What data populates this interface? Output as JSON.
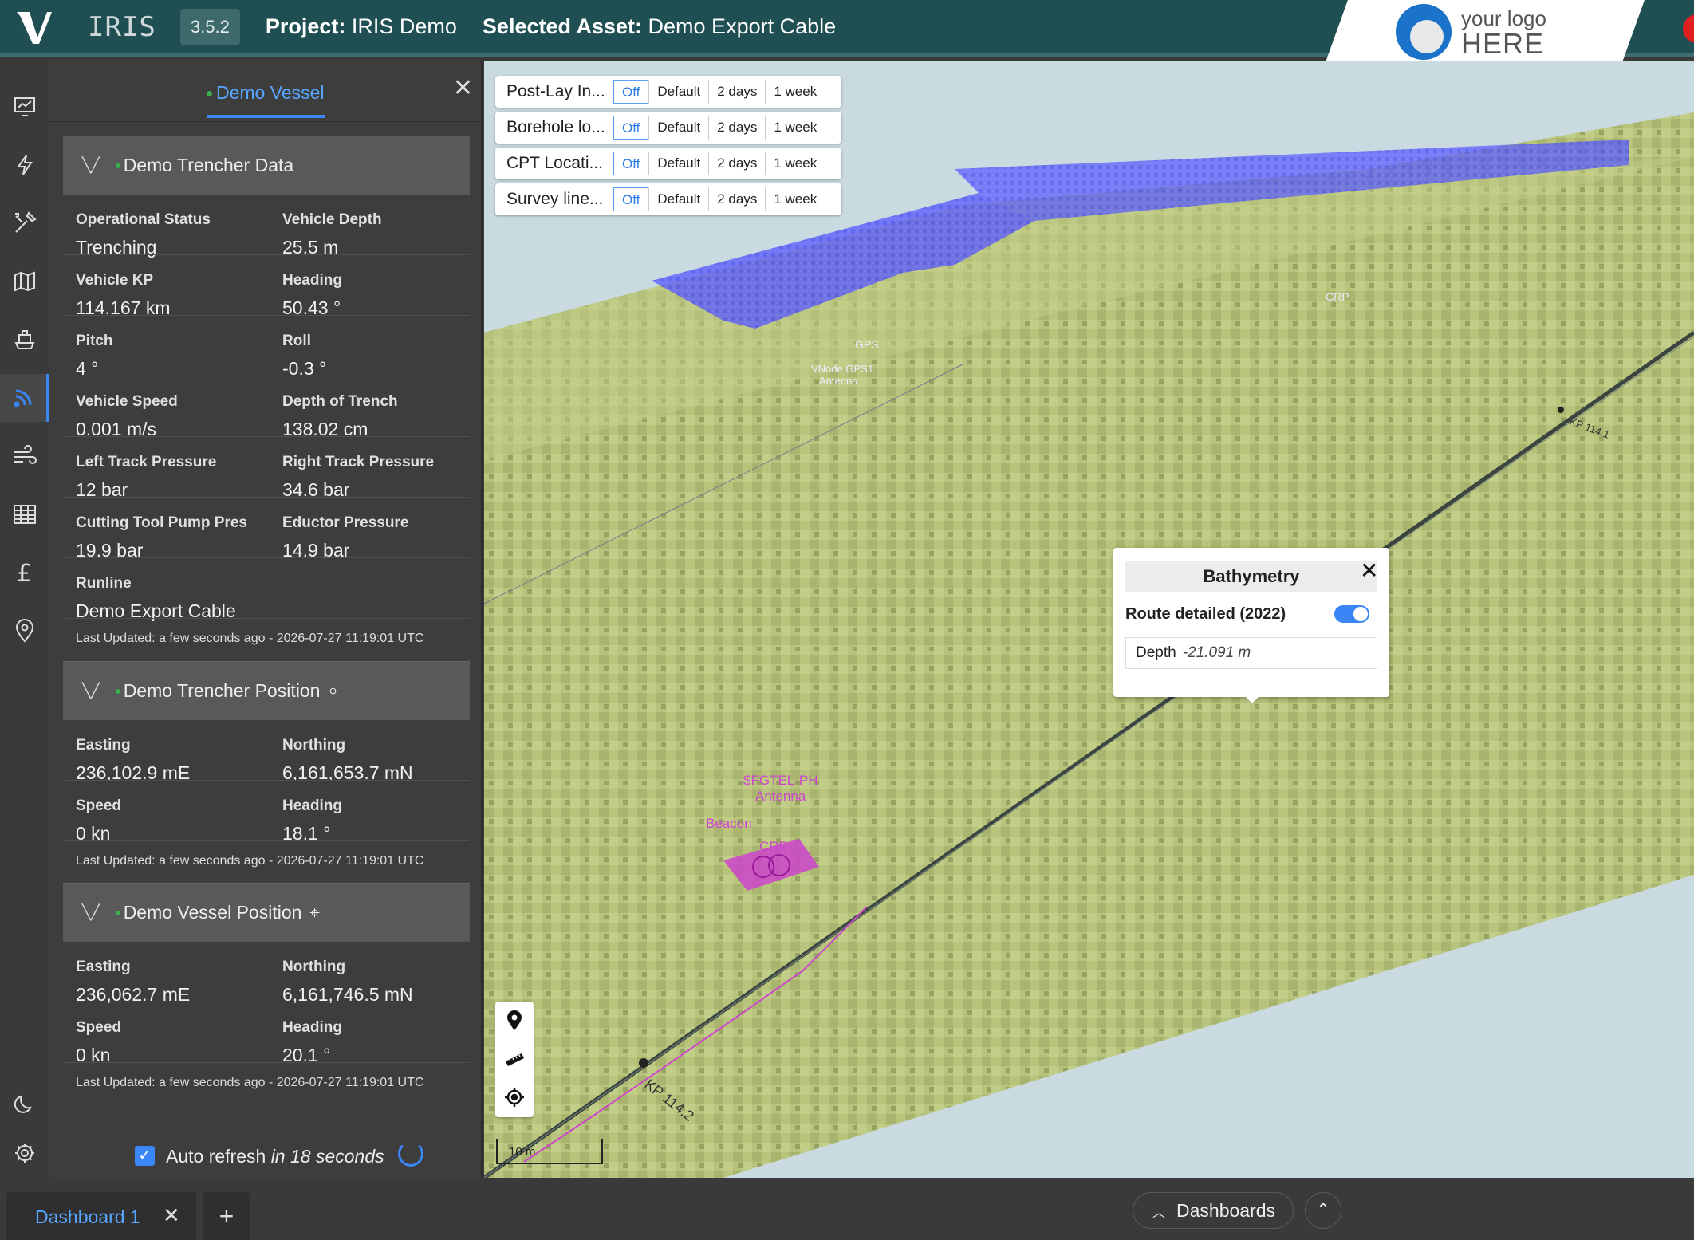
{
  "header": {
    "app_name": "IRIS",
    "version": "3.5.2",
    "project_label": "Project:",
    "project_value": "IRIS Demo",
    "asset_label": "Selected Asset:",
    "asset_value": "Demo Export Cable",
    "brand_line1": "your logo",
    "brand_line2": "HERE"
  },
  "nav": [
    "dashboard-icon",
    "lightning-icon",
    "tools-icon",
    "map-icon",
    "ship-icon",
    "feed-icon",
    "wind-icon",
    "table-icon",
    "pound-icon",
    "location-pin-icon",
    "moon-icon",
    "gear-icon"
  ],
  "panel": {
    "tab": "Demo Vessel",
    "sections": [
      {
        "title": "Demo Trencher Data",
        "fields": [
          {
            "label": "Operational Status",
            "value": "Trenching"
          },
          {
            "label": "Vehicle Depth",
            "value": "25.5 m"
          },
          {
            "label": "Vehicle KP",
            "value": "114.167 km"
          },
          {
            "label": "Heading",
            "value": "50.43 °"
          },
          {
            "label": "Pitch",
            "value": "4 °"
          },
          {
            "label": "Roll",
            "value": "-0.3 °"
          },
          {
            "label": "Vehicle Speed",
            "value": "0.001 m/s"
          },
          {
            "label": "Depth of Trench",
            "value": "138.02 cm"
          },
          {
            "label": "Left Track Pressure",
            "value": "12 bar"
          },
          {
            "label": "Right Track Pressure",
            "value": "34.6 bar"
          },
          {
            "label": "Cutting Tool Pump Pres",
            "value": "19.9 bar"
          },
          {
            "label": "Eductor Pressure",
            "value": "14.9 bar"
          },
          {
            "label": "Runline",
            "value": "Demo Export Cable"
          }
        ],
        "updated": "Last Updated: a few seconds ago - 2026-07-27 11:19:01 UTC"
      },
      {
        "title": "Demo Trencher Position",
        "fields": [
          {
            "label": "Easting",
            "value": "236,102.9 mE"
          },
          {
            "label": "Northing",
            "value": "6,161,653.7 mN"
          },
          {
            "label": "Speed",
            "value": "0 kn"
          },
          {
            "label": "Heading",
            "value": "18.1 °"
          }
        ],
        "updated": "Last Updated: a few seconds ago - 2026-07-27 11:19:01 UTC"
      },
      {
        "title": "Demo Vessel Position",
        "fields": [
          {
            "label": "Easting",
            "value": "236,062.7 mE"
          },
          {
            "label": "Northing",
            "value": "6,161,746.5 mN"
          },
          {
            "label": "Speed",
            "value": "0 kn"
          },
          {
            "label": "Heading",
            "value": "20.1 °"
          }
        ],
        "updated": "Last Updated: a few seconds ago - 2026-07-27 11:19:01 UTC"
      }
    ],
    "refresh_label": "Auto refresh",
    "refresh_countdown": "in 18 seconds"
  },
  "layers": [
    {
      "name": "Post-Lay In...",
      "options": [
        "Off",
        "Default",
        "2 days",
        "1 week"
      ],
      "selected": "Off"
    },
    {
      "name": "Borehole lo...",
      "options": [
        "Off",
        "Default",
        "2 days",
        "1 week"
      ],
      "selected": "Off"
    },
    {
      "name": "CPT Locati...",
      "options": [
        "Off",
        "Default",
        "2 days",
        "1 week"
      ],
      "selected": "Off"
    },
    {
      "name": "Survey line...",
      "options": [
        "Off",
        "Default",
        "2 days",
        "1 week"
      ],
      "selected": "Off"
    }
  ],
  "map_labels": {
    "crp_top": "CRP",
    "gps": "GPS",
    "vnode1": "VNode GPS1",
    "vnode2": "Antenna",
    "kp_right": "KP 114.1",
    "fgtel1": "$FGTEL-PH",
    "fgtel2": "Antenna",
    "beacon": "Beacon",
    "crp_bottom": "CRP",
    "kp_bottom": "KP 114.2",
    "scale": "10 m"
  },
  "popup": {
    "title": "Bathymetry",
    "layer": "Route detailed (2022)",
    "toggle_on": true,
    "row_label": "Depth",
    "row_value": "-21.091 m"
  },
  "bottom": {
    "tab_label": "Dashboard 1",
    "dashboards_label": "Dashboards"
  },
  "colors": {
    "accent": "#3b86f7",
    "topbar": "#1f4f52",
    "seabed": "#b8c77a",
    "vessel_overlay": "#5a5cff",
    "trencher": "#cc44cc"
  }
}
